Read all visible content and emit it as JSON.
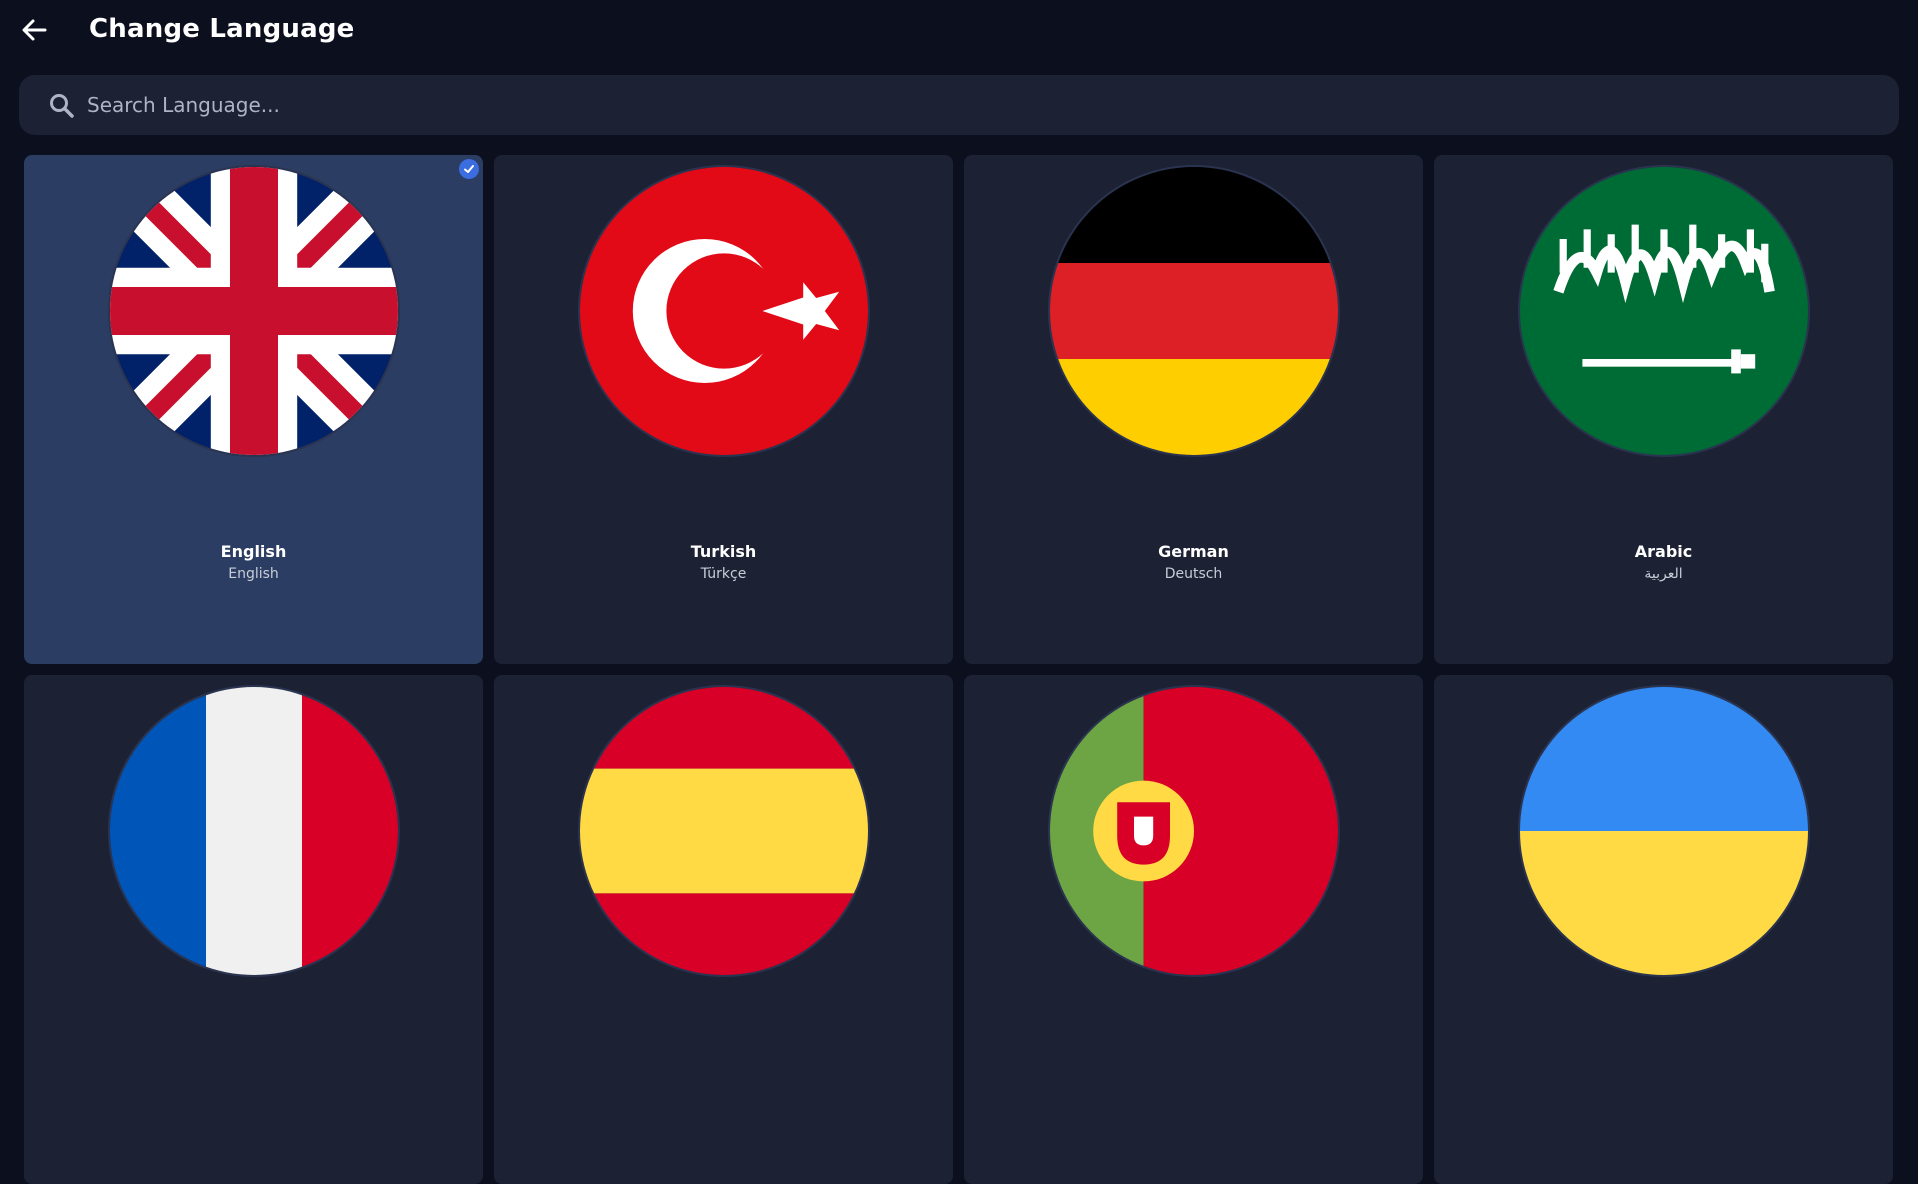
{
  "header": {
    "back_icon": "arrow-left-icon",
    "title": "Change Language"
  },
  "search": {
    "icon": "search-icon",
    "placeholder": "Search Language...",
    "value": ""
  },
  "languages": [
    {
      "name": "English",
      "native": "English",
      "flag": "uk-flag-icon",
      "selected": true
    },
    {
      "name": "Turkish",
      "native": "Türkçe",
      "flag": "turkey-flag-icon",
      "selected": false
    },
    {
      "name": "German",
      "native": "Deutsch",
      "flag": "germany-flag-icon",
      "selected": false
    },
    {
      "name": "Arabic",
      "native": "العربية",
      "flag": "saudi-arabia-flag-icon",
      "selected": false
    },
    {
      "name": "",
      "native": "",
      "flag": "france-flag-icon",
      "selected": false
    },
    {
      "name": "",
      "native": "",
      "flag": "spain-flag-icon",
      "selected": false
    },
    {
      "name": "",
      "native": "",
      "flag": "portugal-flag-icon",
      "selected": false
    },
    {
      "name": "",
      "native": "",
      "flag": "ukraine-flag-icon",
      "selected": false
    }
  ],
  "colors": {
    "background": "#0b0f1e",
    "card": "#1c2133",
    "card_selected": "#2b3d62",
    "accent": "#3b6ce0"
  }
}
